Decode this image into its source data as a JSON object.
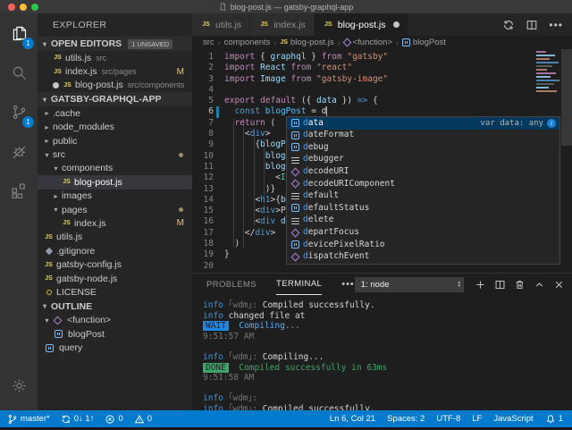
{
  "window": {
    "title": "blog-post.js — gatsby-graphql-app"
  },
  "activity_bar": {
    "items": [
      {
        "name": "explorer",
        "icon": "files-icon",
        "badge": "1",
        "active": true
      },
      {
        "name": "search",
        "icon": "search-icon"
      },
      {
        "name": "source-control",
        "icon": "source-control-icon",
        "badge": "1"
      },
      {
        "name": "debug",
        "icon": "debug-icon"
      },
      {
        "name": "extensions",
        "icon": "extensions-icon"
      }
    ],
    "bottom_icon": "gear-icon"
  },
  "sidebar": {
    "title": "EXPLORER",
    "open_editors": {
      "header": "OPEN EDITORS",
      "badge": "1 UNSAVED",
      "files": [
        {
          "icon": "js",
          "label": "utils.js",
          "desc": "src"
        },
        {
          "icon": "js",
          "label": "index.js",
          "desc": "src/pages",
          "badge": "M"
        },
        {
          "icon": "js",
          "label": "blog-post.js",
          "desc": "src/components",
          "pre_dot": true
        }
      ]
    },
    "project": {
      "header": "GATSBY-GRAPHQL-APP",
      "items": [
        {
          "twisty": "collapsed",
          "icon": "folder",
          "label": ".cache",
          "indent": 1
        },
        {
          "twisty": "collapsed",
          "icon": "folder",
          "label": "node_modules",
          "indent": 1
        },
        {
          "twisty": "collapsed",
          "icon": "folder",
          "label": "public",
          "indent": 1
        },
        {
          "twisty": "expanded",
          "icon": "folder",
          "label": "src",
          "indent": 1,
          "right_dot": true
        },
        {
          "twisty": "expanded",
          "icon": "folder",
          "label": "components",
          "indent": 2
        },
        {
          "icon": "js",
          "label": "blog-post.js",
          "indent": 3,
          "selected": true
        },
        {
          "twisty": "collapsed",
          "icon": "folder",
          "label": "images",
          "indent": 2
        },
        {
          "twisty": "expanded",
          "icon": "folder",
          "label": "pages",
          "indent": 2,
          "right_dot": true
        },
        {
          "icon": "js",
          "label": "index.js",
          "indent": 3,
          "badge": "M"
        },
        {
          "icon": "js",
          "label": "utils.js",
          "indent": 1
        },
        {
          "icon": "gitignore",
          "label": ".gitignore",
          "indent": 1
        },
        {
          "icon": "js",
          "label": "gatsby-config.js",
          "indent": 1
        },
        {
          "icon": "js",
          "label": "gatsby-node.js",
          "indent": 1
        },
        {
          "icon": "license",
          "label": "LICENSE",
          "indent": 1
        }
      ]
    },
    "outline": {
      "header": "OUTLINE",
      "items": [
        {
          "twisty": "expanded",
          "icon": "fn",
          "label": "<function>",
          "indent": 1
        },
        {
          "icon": "var",
          "label": "blogPost",
          "indent": 2
        },
        {
          "icon": "var",
          "label": "query",
          "indent": 1
        }
      ]
    }
  },
  "editor": {
    "tabs": [
      {
        "label": "utils.js",
        "active": false,
        "dirty": false
      },
      {
        "label": "index.js",
        "active": false,
        "dirty": false
      },
      {
        "label": "blog-post.js",
        "active": true,
        "dirty": true
      }
    ],
    "action_icons": [
      "synchronize-changes-icon",
      "split-editor-icon",
      "more-actions-icon"
    ],
    "breadcrumb": [
      {
        "label": "src"
      },
      {
        "label": "components"
      },
      {
        "icon": "js",
        "label": "blog-post.js"
      },
      {
        "icon": "fn",
        "label": "<function>"
      },
      {
        "icon": "var",
        "label": "blogPost"
      }
    ],
    "code": [
      {
        "n": 1,
        "t": [
          [
            "import",
            "kw"
          ],
          [
            " { ",
            "pn"
          ],
          [
            "graphql",
            "vr"
          ],
          [
            " } ",
            "pn"
          ],
          [
            "from",
            "kw"
          ],
          [
            " ",
            "pn"
          ],
          [
            "\"gatsby\"",
            "st"
          ]
        ]
      },
      {
        "n": 2,
        "t": [
          [
            "import",
            "kw"
          ],
          [
            " ",
            "pn"
          ],
          [
            "React",
            "vr"
          ],
          [
            " ",
            "pn"
          ],
          [
            "from",
            "kw"
          ],
          [
            " ",
            "pn"
          ],
          [
            "\"react\"",
            "st"
          ]
        ]
      },
      {
        "n": 3,
        "t": [
          [
            "import",
            "kw"
          ],
          [
            " ",
            "pn"
          ],
          [
            "Image",
            "vr"
          ],
          [
            " ",
            "pn"
          ],
          [
            "from",
            "kw"
          ],
          [
            " ",
            "pn"
          ],
          [
            "\"gatsby-image\"",
            "st"
          ]
        ]
      },
      {
        "n": 4,
        "t": []
      },
      {
        "n": 5,
        "t": [
          [
            "export",
            "kw"
          ],
          [
            " ",
            "pn"
          ],
          [
            "default",
            "kw"
          ],
          [
            " ({ ",
            "pn"
          ],
          [
            "data",
            "vr"
          ],
          [
            " }) ",
            "pn"
          ],
          [
            "=>",
            "ar"
          ],
          [
            " {",
            "pn"
          ]
        ]
      },
      {
        "n": 6,
        "t": [
          [
            "  ",
            "pn"
          ],
          [
            "const",
            "kw2"
          ],
          [
            " ",
            "pn"
          ],
          [
            "blogPost",
            "vr2"
          ],
          [
            " = d",
            "pn"
          ]
        ],
        "mod": true,
        "cursor": true
      },
      {
        "n": 7,
        "t": [
          [
            "  ",
            "pn"
          ],
          [
            "return",
            "kw"
          ],
          [
            " (",
            "pn"
          ]
        ]
      },
      {
        "n": 8,
        "t": [
          [
            "    <",
            "pn"
          ],
          [
            "div",
            "tg"
          ],
          [
            ">",
            "pn"
          ]
        ]
      },
      {
        "n": 9,
        "t": [
          [
            "      {",
            "pn"
          ],
          [
            "blogP",
            "vr"
          ]
        ]
      },
      {
        "n": 10,
        "t": [
          [
            "        ",
            "pn"
          ],
          [
            "blog",
            "vr"
          ]
        ]
      },
      {
        "n": 11,
        "t": [
          [
            "        ",
            "pn"
          ],
          [
            "blog",
            "vr"
          ]
        ]
      },
      {
        "n": 12,
        "t": [
          [
            "          <",
            "pn"
          ],
          [
            "I",
            "cp"
          ]
        ]
      },
      {
        "n": 13,
        "t": [
          [
            "        )}",
            "pn"
          ]
        ]
      },
      {
        "n": 14,
        "t": [
          [
            "      <",
            "pn"
          ],
          [
            "h1",
            "tg"
          ],
          [
            ">{",
            "pn"
          ],
          [
            "b",
            "vr"
          ]
        ]
      },
      {
        "n": 15,
        "t": [
          [
            "      <",
            "pn"
          ],
          [
            "div",
            "tg"
          ],
          [
            ">",
            "pn"
          ],
          [
            "P",
            "pn"
          ]
        ]
      },
      {
        "n": 16,
        "t": [
          [
            "      <",
            "pn"
          ],
          [
            "div",
            "tg"
          ],
          [
            " ",
            "pn"
          ],
          [
            "d",
            "vr"
          ]
        ]
      },
      {
        "n": 17,
        "t": [
          [
            "    </",
            "pn"
          ],
          [
            "div",
            "tg"
          ],
          [
            ">",
            "pn"
          ]
        ]
      },
      {
        "n": 18,
        "t": [
          [
            "  )",
            "pn"
          ]
        ]
      },
      {
        "n": 19,
        "t": [
          [
            "}",
            "pn"
          ]
        ]
      },
      {
        "n": 20,
        "t": []
      }
    ],
    "suggest": {
      "items": [
        {
          "icon": "var",
          "label": "data",
          "selected": true,
          "detail": "var data: any",
          "info": true
        },
        {
          "icon": "var",
          "label": "dateFormat"
        },
        {
          "icon": "var",
          "label": "debug"
        },
        {
          "icon": "kw",
          "label": "debugger"
        },
        {
          "icon": "fn",
          "label": "decodeURI"
        },
        {
          "icon": "fn",
          "label": "decodeURIComponent"
        },
        {
          "icon": "kw",
          "label": "default"
        },
        {
          "icon": "var",
          "label": "defaultStatus"
        },
        {
          "icon": "kw",
          "label": "delete"
        },
        {
          "icon": "fn",
          "label": "departFocus"
        },
        {
          "icon": "var",
          "label": "devicePixelRatio"
        },
        {
          "icon": "fn",
          "label": "dispatchEvent"
        }
      ]
    }
  },
  "panel": {
    "tabs": [
      {
        "label": "PROBLEMS",
        "active": false
      },
      {
        "label": "TERMINAL",
        "active": true
      }
    ],
    "more": "•••",
    "terminal_select": "1: node",
    "header_icons": [
      "new-terminal-icon",
      "split-terminal-icon",
      "kill-terminal-icon",
      "maximize-panel-icon",
      "close-panel-icon"
    ],
    "terminal_lines": [
      [
        [
          "info",
          "ti"
        ],
        [
          " ｢wdm｣",
          "td"
        ],
        [
          ":",
          "td"
        ],
        [
          " Compiled successfully.",
          "tw"
        ]
      ],
      [
        [
          "info",
          "ti"
        ],
        [
          " changed file at",
          "tw"
        ]
      ],
      [
        [
          "WAIT",
          "bw"
        ],
        [
          "  ",
          "td"
        ],
        [
          "Compiling...",
          "tb"
        ]
      ],
      [
        [
          "9:51:57 AM",
          "td"
        ]
      ],
      [],
      [
        [
          "info",
          "ti"
        ],
        [
          " ｢wdm｣",
          "td"
        ],
        [
          ":",
          "td"
        ],
        [
          " Compiling...",
          "tw"
        ]
      ],
      [
        [
          "DONE",
          "bd"
        ],
        [
          "  ",
          "td"
        ],
        [
          "Compiled successfully in 63ms",
          "tg2"
        ]
      ],
      [
        [
          "9:51:58 AM",
          "td"
        ]
      ],
      [],
      [
        [
          "info",
          "ti"
        ],
        [
          " ｢wdm｣",
          "td"
        ],
        [
          ":",
          "td"
        ]
      ],
      [
        [
          "info",
          "ti"
        ],
        [
          " ｢wdm｣",
          "td"
        ],
        [
          ":",
          "td"
        ],
        [
          " Compiled successfully.",
          "tw"
        ]
      ]
    ]
  },
  "status_bar": {
    "left": [
      {
        "icon": "git-branch-icon",
        "label": "master*"
      },
      {
        "icon": "sync-icon",
        "label": "0↓ 1↑"
      },
      {
        "icon": "error-icon",
        "label": "0"
      },
      {
        "icon": "warning-icon",
        "label": "0"
      }
    ],
    "right": [
      {
        "label": "Ln 6, Col 21"
      },
      {
        "label": "Spaces: 2"
      },
      {
        "label": "UTF-8"
      },
      {
        "label": "LF"
      },
      {
        "label": "JavaScript"
      },
      {
        "icon": "bell-icon",
        "label": "1"
      }
    ]
  },
  "colors": {
    "accent": "#007acc",
    "git_modified": "#e2c08d",
    "suggest_selected": "#04395e",
    "done_green": "#3da869",
    "wait_blue": "#1c88e5"
  }
}
